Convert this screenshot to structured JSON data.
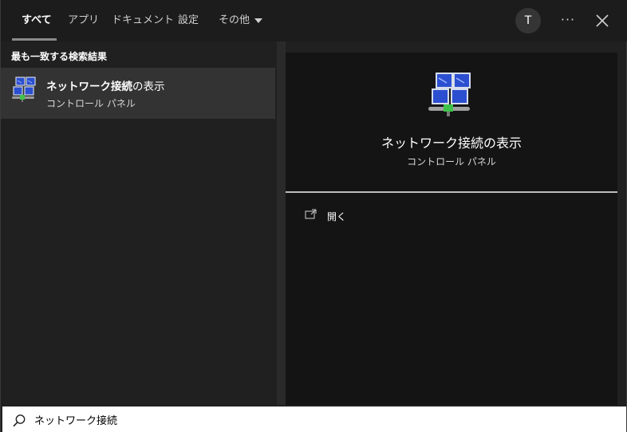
{
  "tabs": [
    {
      "label": "すべて",
      "active": true
    },
    {
      "label": "アプリ"
    },
    {
      "label": "ドキュメント"
    },
    {
      "label": "設定"
    },
    {
      "label": "その他"
    }
  ],
  "account": {
    "initial": "T"
  },
  "more_label": "···",
  "results": {
    "section_title": "最も一致する検索結果",
    "best_match": {
      "title_bold": "ネットワーク接続",
      "title_rest": "の表示",
      "subtitle": "コントロール パネル",
      "icon": "network-connections-icon"
    }
  },
  "preview": {
    "title": "ネットワーク接続の表示",
    "subtitle": "コントロール パネル",
    "actions": [
      {
        "label": "開く",
        "icon": "open-icon"
      }
    ]
  },
  "search": {
    "value": "ネットワーク接続"
  },
  "colors": {
    "background": "#202020",
    "preview_bg": "#141414",
    "selected_row": "#333333"
  }
}
